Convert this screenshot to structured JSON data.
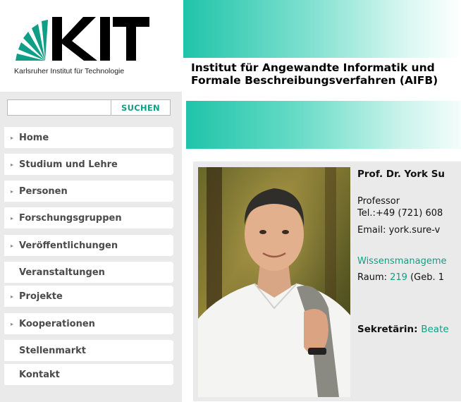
{
  "brand": {
    "logo_text": "KIT",
    "subtitle": "Karlsruher Institut für Technologie",
    "colors": {
      "teal": "#119e86",
      "accent_gradient_start": "#1fc4aa",
      "sidebar_bg": "#eaeaea"
    }
  },
  "header": {
    "institute_line1": "Institut für Angewandte Informatik und",
    "institute_line2": "Formale Beschreibungsverfahren (AIFB)"
  },
  "search": {
    "value": "",
    "placeholder": "",
    "button_label": "SUCHEN"
  },
  "nav": {
    "items": [
      {
        "label": "Home",
        "arrow": true
      },
      {
        "label": "Studium und Lehre",
        "arrow": true
      },
      {
        "label": "Personen",
        "arrow": true
      },
      {
        "label": "Forschungsgruppen",
        "arrow": true
      },
      {
        "label": "Veröffentlichungen",
        "arrow": true
      },
      {
        "label": "Veranstaltungen",
        "arrow": false
      },
      {
        "label": "Projekte",
        "arrow": true
      },
      {
        "label": "Kooperationen",
        "arrow": true
      },
      {
        "label": "Stellenmarkt",
        "arrow": false
      },
      {
        "label": "Kontakt",
        "arrow": false
      }
    ],
    "arrow_glyph": "▸"
  },
  "profile": {
    "name": "Prof. Dr. York Su",
    "role": "Professor",
    "tel": "Tel.:+49 (721) 608",
    "email": "Email: york.sure-v",
    "group_link": "Wissensmanageme",
    "room_prefix": "Raum: ",
    "room_number": "219",
    "room_suffix": " (Geb. 1",
    "secretary_label": "Sekretärin: ",
    "secretary_name": "Beate"
  },
  "icons": {
    "nav_arrow": "triangle-right-icon",
    "logo": "kit-logo"
  }
}
